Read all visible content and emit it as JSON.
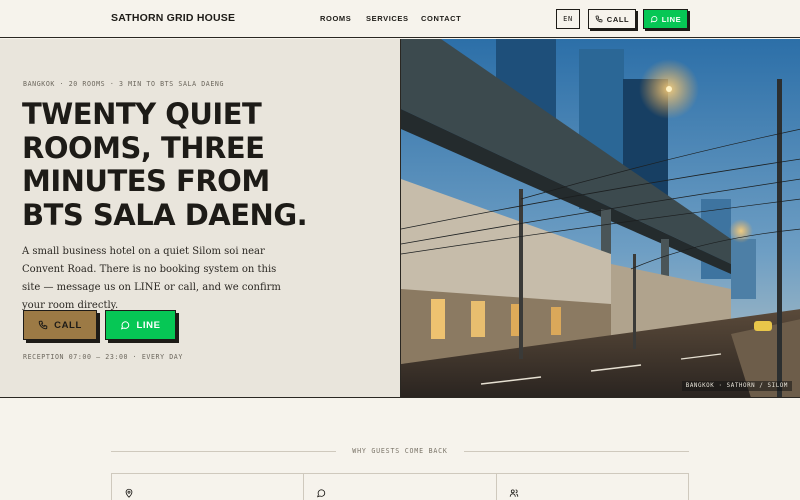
{
  "header": {
    "brand": "SATHORN GRID HOUSE",
    "nav": [
      "ROOMS",
      "SERVICES",
      "CONTACT"
    ],
    "lang_label": "EN",
    "call_label": "CALL",
    "line_label": "LINE"
  },
  "hero": {
    "eyebrow": "BANGKOK · 20 ROOMS · 3 MIN TO BTS SALA DAENG",
    "title_lines": [
      "TWENTY QUIET",
      "ROOMS, THREE",
      "MINUTES FROM",
      "BTS SALA DAENG."
    ],
    "lede": "A small business hotel on a quiet Silom soi near Convent Road. There is no booking system on this site — message us on LINE or call, and we confirm your room directly.",
    "call_label": "CALL",
    "line_label": "LINE",
    "hours": "RECEPTION 07:00 – 23:00 · EVERY DAY",
    "photo_caption": "BANGKOK · SATHORN / SILOM"
  },
  "why": {
    "label": "WHY GUESTS COME BACK",
    "cards": [
      {
        "icon": "map-pin-icon"
      },
      {
        "icon": "chat-icon"
      },
      {
        "icon": "users-icon"
      }
    ]
  },
  "colors": {
    "background": "#f6f3ec",
    "hero_panel": "#e9e5dc",
    "ink": "#1d1b17",
    "call_accent": "#9c7a45",
    "line_green": "#06c755"
  }
}
